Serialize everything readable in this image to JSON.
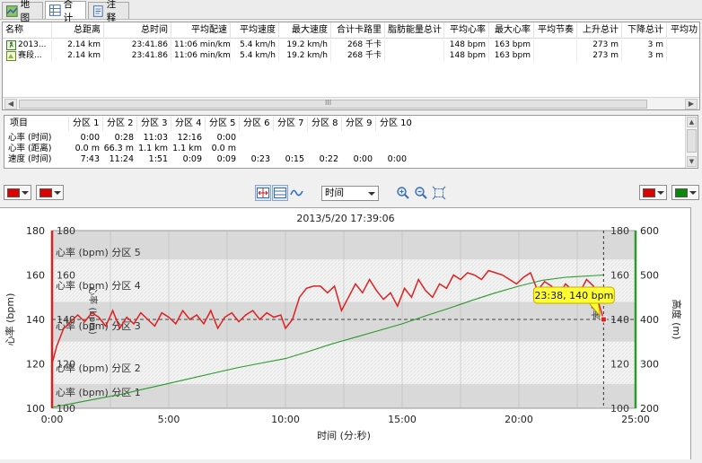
{
  "tabs": [
    {
      "label": "地图",
      "icon": "map-icon"
    },
    {
      "label": "合计",
      "icon": "table-icon"
    },
    {
      "label": "注释",
      "icon": "note-icon"
    }
  ],
  "summary": {
    "headers": [
      "名称",
      "总距离",
      "总时间",
      "平均配速",
      "平均速度",
      "最大速度",
      "合计卡路里",
      "脂肪能量总计",
      "平均心率",
      "最大心率",
      "平均节奏",
      "上升总计",
      "下降总计",
      "平均功"
    ],
    "rows": [
      {
        "icon": "activity-icon",
        "cells": [
          "2013...",
          "2.14 km",
          "23:41.86",
          "11:06 min/km",
          "5.4 km/h",
          "19.2 km/h",
          "268 千卡",
          "",
          "148 bpm",
          "163 bpm",
          "",
          "273 m",
          "3 m",
          ""
        ]
      },
      {
        "icon": "race-icon",
        "cells": [
          "赛段...",
          "2.14 km",
          "23:41.86",
          "11:06 min/km",
          "5.4 km/h",
          "19.2 km/h",
          "268 千卡",
          "",
          "148 bpm",
          "163 bpm",
          "",
          "273 m",
          "3 m",
          ""
        ]
      }
    ],
    "hscroll_grip": "III"
  },
  "zones": {
    "headers": [
      "项目",
      "分区 1",
      "分区 2",
      "分区 3",
      "分区 4",
      "分区 5",
      "分区 6",
      "分区 7",
      "分区 8",
      "分区 9",
      "分区 10"
    ],
    "rows": [
      {
        "label": "心率 (时间)",
        "cells": [
          "0:00",
          "0:28",
          "11:03",
          "12:16",
          "0:00",
          "",
          "",
          "",
          "",
          ""
        ]
      },
      {
        "label": "心率 (距离)",
        "cells": [
          "0.0 m",
          "66.3 m",
          "1.1 km",
          "1.1 km",
          "0.0 m",
          "",
          "",
          "",
          "",
          ""
        ]
      },
      {
        "label": "速度 (时间)",
        "cells": [
          "7:43",
          "11:24",
          "1:51",
          "0:09",
          "0:09",
          "0:23",
          "0:15",
          "0:22",
          "0:00",
          "0:00"
        ]
      }
    ]
  },
  "toolbar": {
    "left_color_1": "#e00000",
    "left_color_2": "#e00000",
    "right_color_1": "#e00000",
    "right_color_2": "#0a8a0a",
    "x_axis_select": "时间",
    "buttons": [
      "fit-width-icon",
      "fit-height-icon",
      "curve-icon",
      "zoom-in-icon",
      "zoom-out-icon",
      "zoom-fit-icon"
    ]
  },
  "chart_data": {
    "type": "line",
    "title": "2013/5/20 17:39:06",
    "xlabel": "时间 (分:秒)",
    "ylabel_left": "心率 (bpm)",
    "ylabel_right": "高度 (m)",
    "x_ticks": [
      "0:00",
      "5:00",
      "10:00",
      "15:00",
      "20:00",
      "25:00"
    ],
    "xlim_minutes": [
      0,
      25
    ],
    "ylim_left": [
      100,
      180
    ],
    "y_ticks_left": [
      100,
      120,
      140,
      160,
      180
    ],
    "ylim_right": [
      200,
      600
    ],
    "y_ticks_right": [
      200,
      300,
      400,
      500,
      600
    ],
    "zones": [
      {
        "label": "心率 (bpm) 分区 1",
        "from": 100,
        "to": 111
      },
      {
        "label": "心率 (bpm) 分区 2",
        "from": 111,
        "to": 130
      },
      {
        "label": "心率 (bpm) 分区 3",
        "from": 130,
        "to": 148
      },
      {
        "label": "心率 (bpm) 分区 4",
        "from": 148,
        "to": 167
      },
      {
        "label": "心率 (bpm) 分区 5",
        "from": 167,
        "to": 180
      }
    ],
    "avg_line": 140,
    "cursor_minute": 23.63,
    "tooltip": "23:38, 140 bpm",
    "series": [
      {
        "name": "心率 (bpm)",
        "color": "#e02020",
        "x": [
          0,
          0.2,
          0.5,
          0.8,
          1.1,
          1.4,
          1.7,
          2.0,
          2.3,
          2.6,
          2.9,
          3.2,
          3.5,
          3.8,
          4.1,
          4.4,
          4.7,
          5.0,
          5.3,
          5.6,
          5.9,
          6.2,
          6.5,
          6.8,
          7.1,
          7.4,
          7.7,
          8.0,
          8.3,
          8.6,
          8.9,
          9.2,
          9.5,
          9.8,
          10.0,
          10.3,
          10.6,
          10.9,
          11.2,
          11.5,
          11.8,
          12.1,
          12.4,
          12.7,
          13.0,
          13.3,
          13.6,
          13.9,
          14.2,
          14.5,
          14.8,
          15.1,
          15.4,
          15.7,
          16.0,
          16.3,
          16.6,
          16.9,
          17.2,
          17.5,
          17.8,
          18.1,
          18.4,
          18.7,
          19.0,
          19.3,
          19.6,
          19.9,
          20.2,
          20.5,
          20.8,
          21.1,
          21.4,
          21.7,
          22.0,
          22.3,
          22.6,
          22.9,
          23.2,
          23.4,
          23.63
        ],
        "y": [
          120,
          128,
          136,
          139,
          142,
          139,
          143,
          141,
          137,
          144,
          136,
          141,
          138,
          143,
          140,
          137,
          143,
          141,
          138,
          144,
          140,
          142,
          138,
          144,
          136,
          141,
          143,
          139,
          142,
          144,
          140,
          143,
          141,
          142,
          136,
          140,
          150,
          154,
          155,
          155,
          152,
          155,
          144,
          150,
          156,
          152,
          158,
          153,
          149,
          152,
          146,
          154,
          150,
          158,
          153,
          150,
          156,
          154,
          160,
          158,
          161,
          160,
          158,
          162,
          161,
          160,
          158,
          156,
          159,
          161,
          153,
          157,
          155,
          151,
          156,
          153,
          152,
          158,
          155,
          148,
          140
        ]
      },
      {
        "name": "高度 (m)",
        "color": "#2a9a2a",
        "axis": "right",
        "x": [
          0,
          1,
          2,
          3,
          4,
          5,
          6,
          7,
          8,
          9,
          10,
          11,
          12,
          13,
          14,
          15,
          16,
          17,
          18,
          19,
          20,
          21,
          22,
          23,
          23.63
        ],
        "y": [
          202,
          212,
          222,
          232,
          244,
          256,
          268,
          280,
          292,
          302,
          312,
          328,
          345,
          360,
          375,
          390,
          408,
          425,
          443,
          460,
          475,
          488,
          495,
          498,
          500
        ]
      }
    ],
    "cursor_series_labels": [
      "心率 (bpm)",
      "心率"
    ],
    "grid": true
  }
}
